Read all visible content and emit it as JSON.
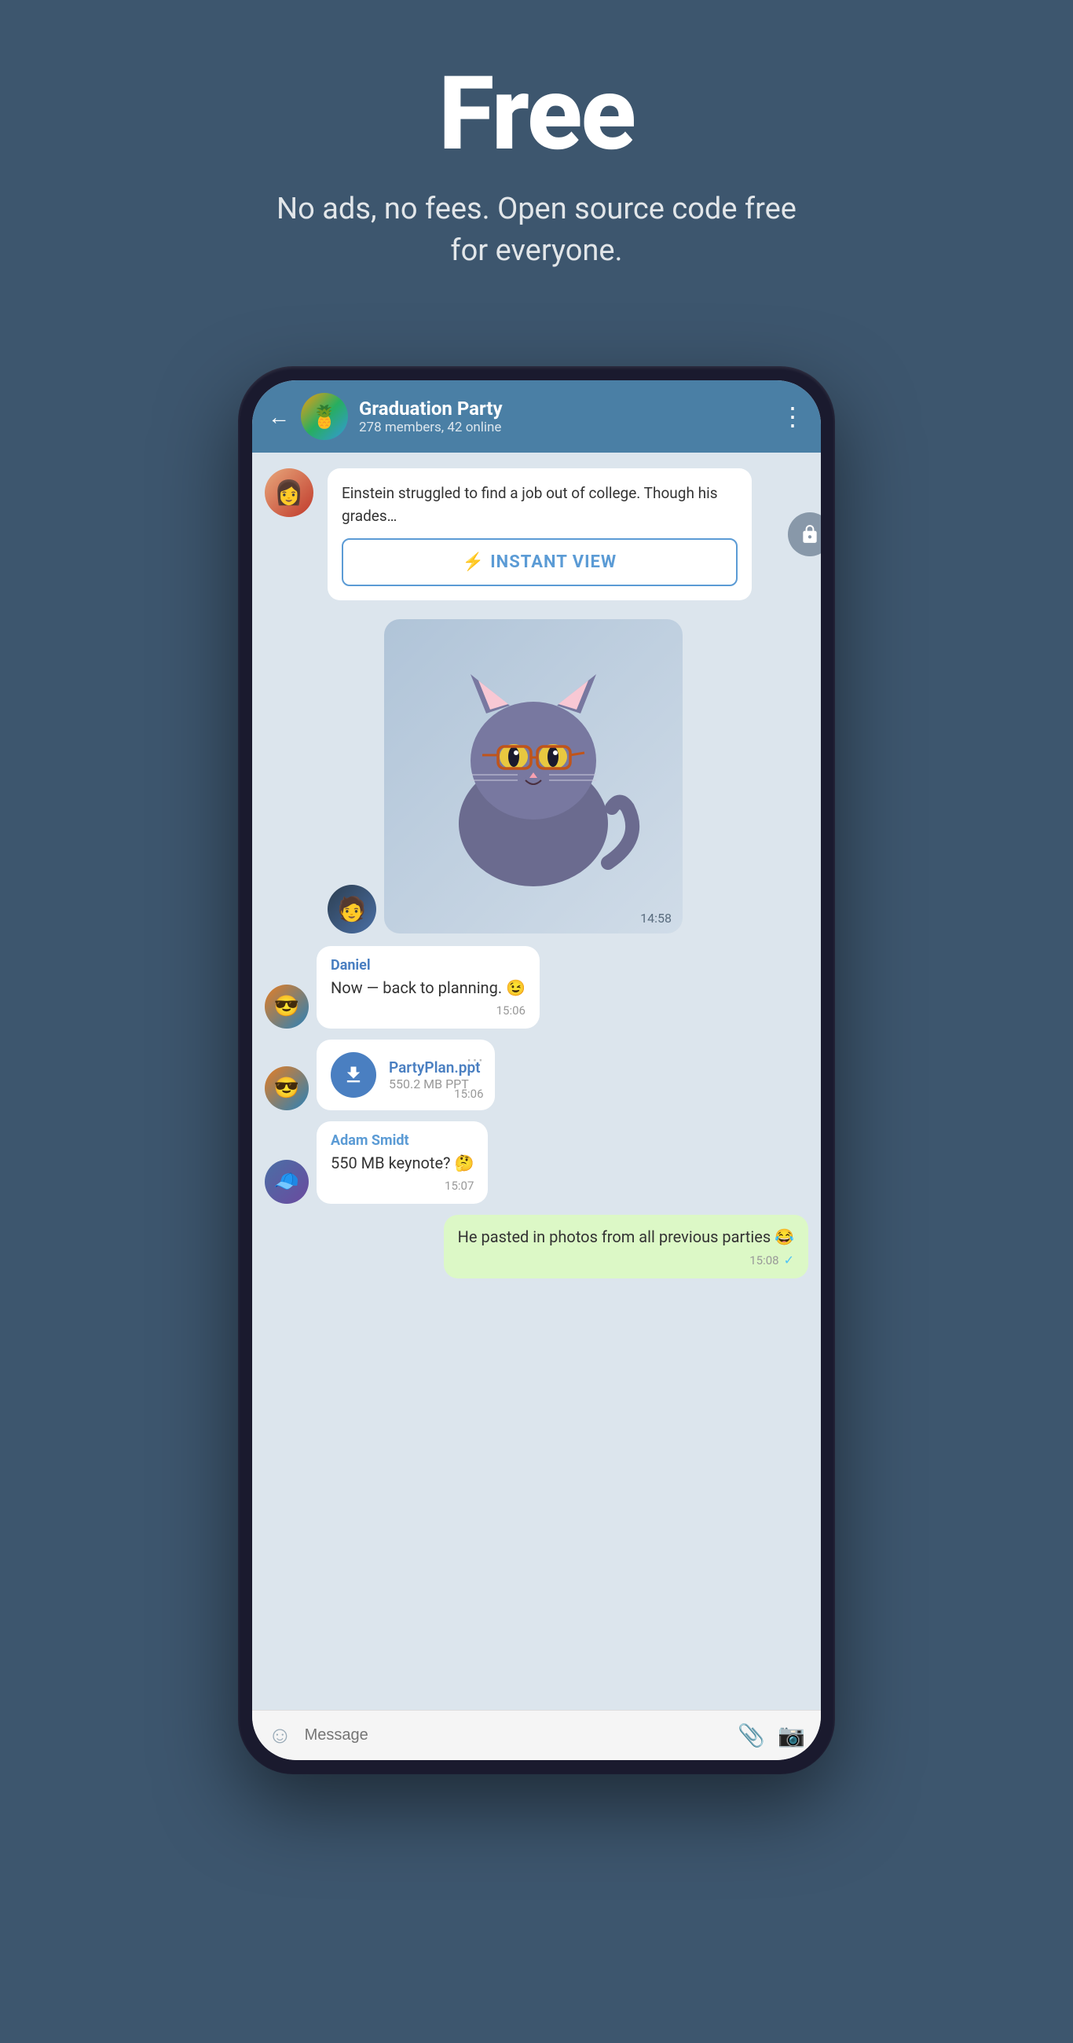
{
  "hero": {
    "title": "Free",
    "subtitle": "No ads, no fees. Open source code free for everyone."
  },
  "chat": {
    "back_label": "←",
    "group_name": "Graduation Party",
    "group_status": "278 members, 42 online",
    "menu_label": "⋮"
  },
  "article_message": {
    "text": "Einstein struggled to find a job out of college. Though his grades…",
    "instant_view_label": "INSTANT VIEW",
    "lightning": "⚡"
  },
  "sticker_message": {
    "time": "14:58"
  },
  "messages": [
    {
      "id": "daniel-msg",
      "sender": "Daniel",
      "text": "Now — back to planning. 😉",
      "time": "15:06",
      "own": false
    },
    {
      "id": "file-msg",
      "file_name": "PartyPlan.ppt",
      "file_size": "550.2 MB PPT",
      "time": "15:06",
      "own": false
    },
    {
      "id": "adam-msg",
      "sender": "Adam Smidt",
      "text": "550 MB keynote? 🤔",
      "time": "15:07",
      "own": false
    },
    {
      "id": "own-msg",
      "text": "He pasted in photos from all previous parties 😂",
      "time": "15:08",
      "own": true,
      "tick": "✓"
    }
  ],
  "input_bar": {
    "placeholder": "Message",
    "emoji_icon": "☺",
    "attach_icon": "📎",
    "camera_icon": "📷"
  }
}
